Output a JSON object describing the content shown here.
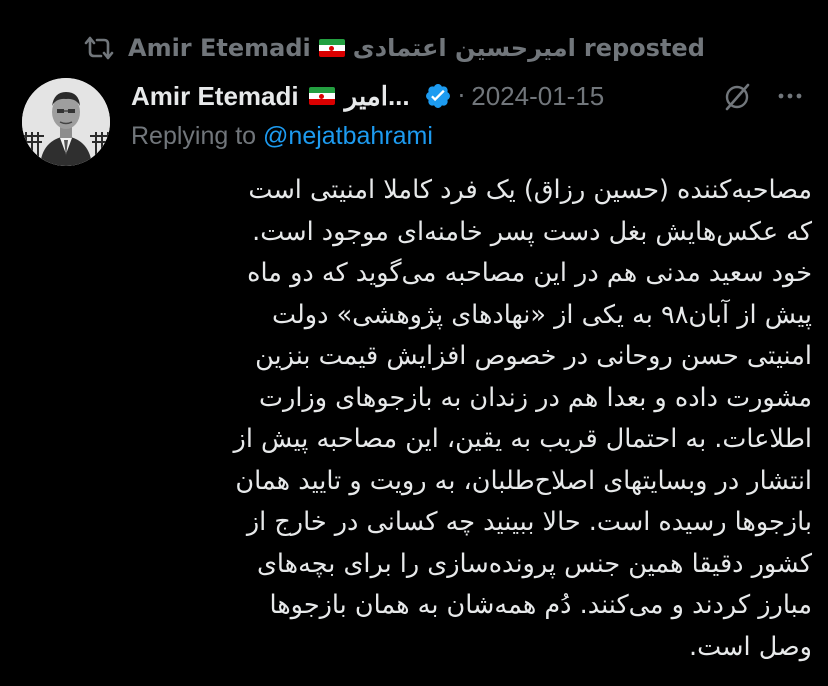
{
  "repost": {
    "name": "Amir Etemadi",
    "name_fa": "امیرحسین اعتمادی",
    "suffix": "reposted",
    "icon": "repost-icon"
  },
  "author": {
    "display_name": "Amir Etemadi",
    "display_name_fa": "امیر...",
    "verified": true,
    "date": "2024-01-15",
    "separator": "·"
  },
  "reply": {
    "prefix": "Replying to",
    "handle": "@nejatbahrami"
  },
  "body_lines": [
    "مصاحبه‌کننده (حسین رزاق) یک فرد کاملا امنیتی است",
    "که عکس‌هایش بغل دست پسر خامنه‌ای موجود است.",
    "خود سعید مدنی هم در این مصاحبه می‌گوید که دو ماه",
    "پیش از آبان۹۸ به یکی از «نهادهای پژوهشی» دولت",
    "امنیتی حسن روحانی در خصوص افزایش قیمت بنزین",
    "مشورت داده و بعدا هم در زندان به بازجوهای وزارت",
    "اطلاعات. به احتمال قریب به یقین، این مصاحبه پیش از",
    "انتشار در وبسایتهای اصلاح‌طلبان، به رویت و تایید همان",
    "بازجوها رسیده است. حالا ببینید چه کسانی در خارج از",
    "کشور دقیقا همین جنس پرونده‌سازی را برای بچه‌های",
    "مبارز کردند و می‌کنند. دُم همه‌شان به همان بازجوها",
    "وصل است."
  ],
  "colors": {
    "background": "#000000",
    "text": "#e7e9ea",
    "muted": "#71767b",
    "link": "#1d9bf0",
    "verified": "#1d9bf0"
  },
  "icons": [
    "repost-icon",
    "iran-flag-icon",
    "verified-badge-icon",
    "grok-icon",
    "more-icon",
    "avatar"
  ]
}
